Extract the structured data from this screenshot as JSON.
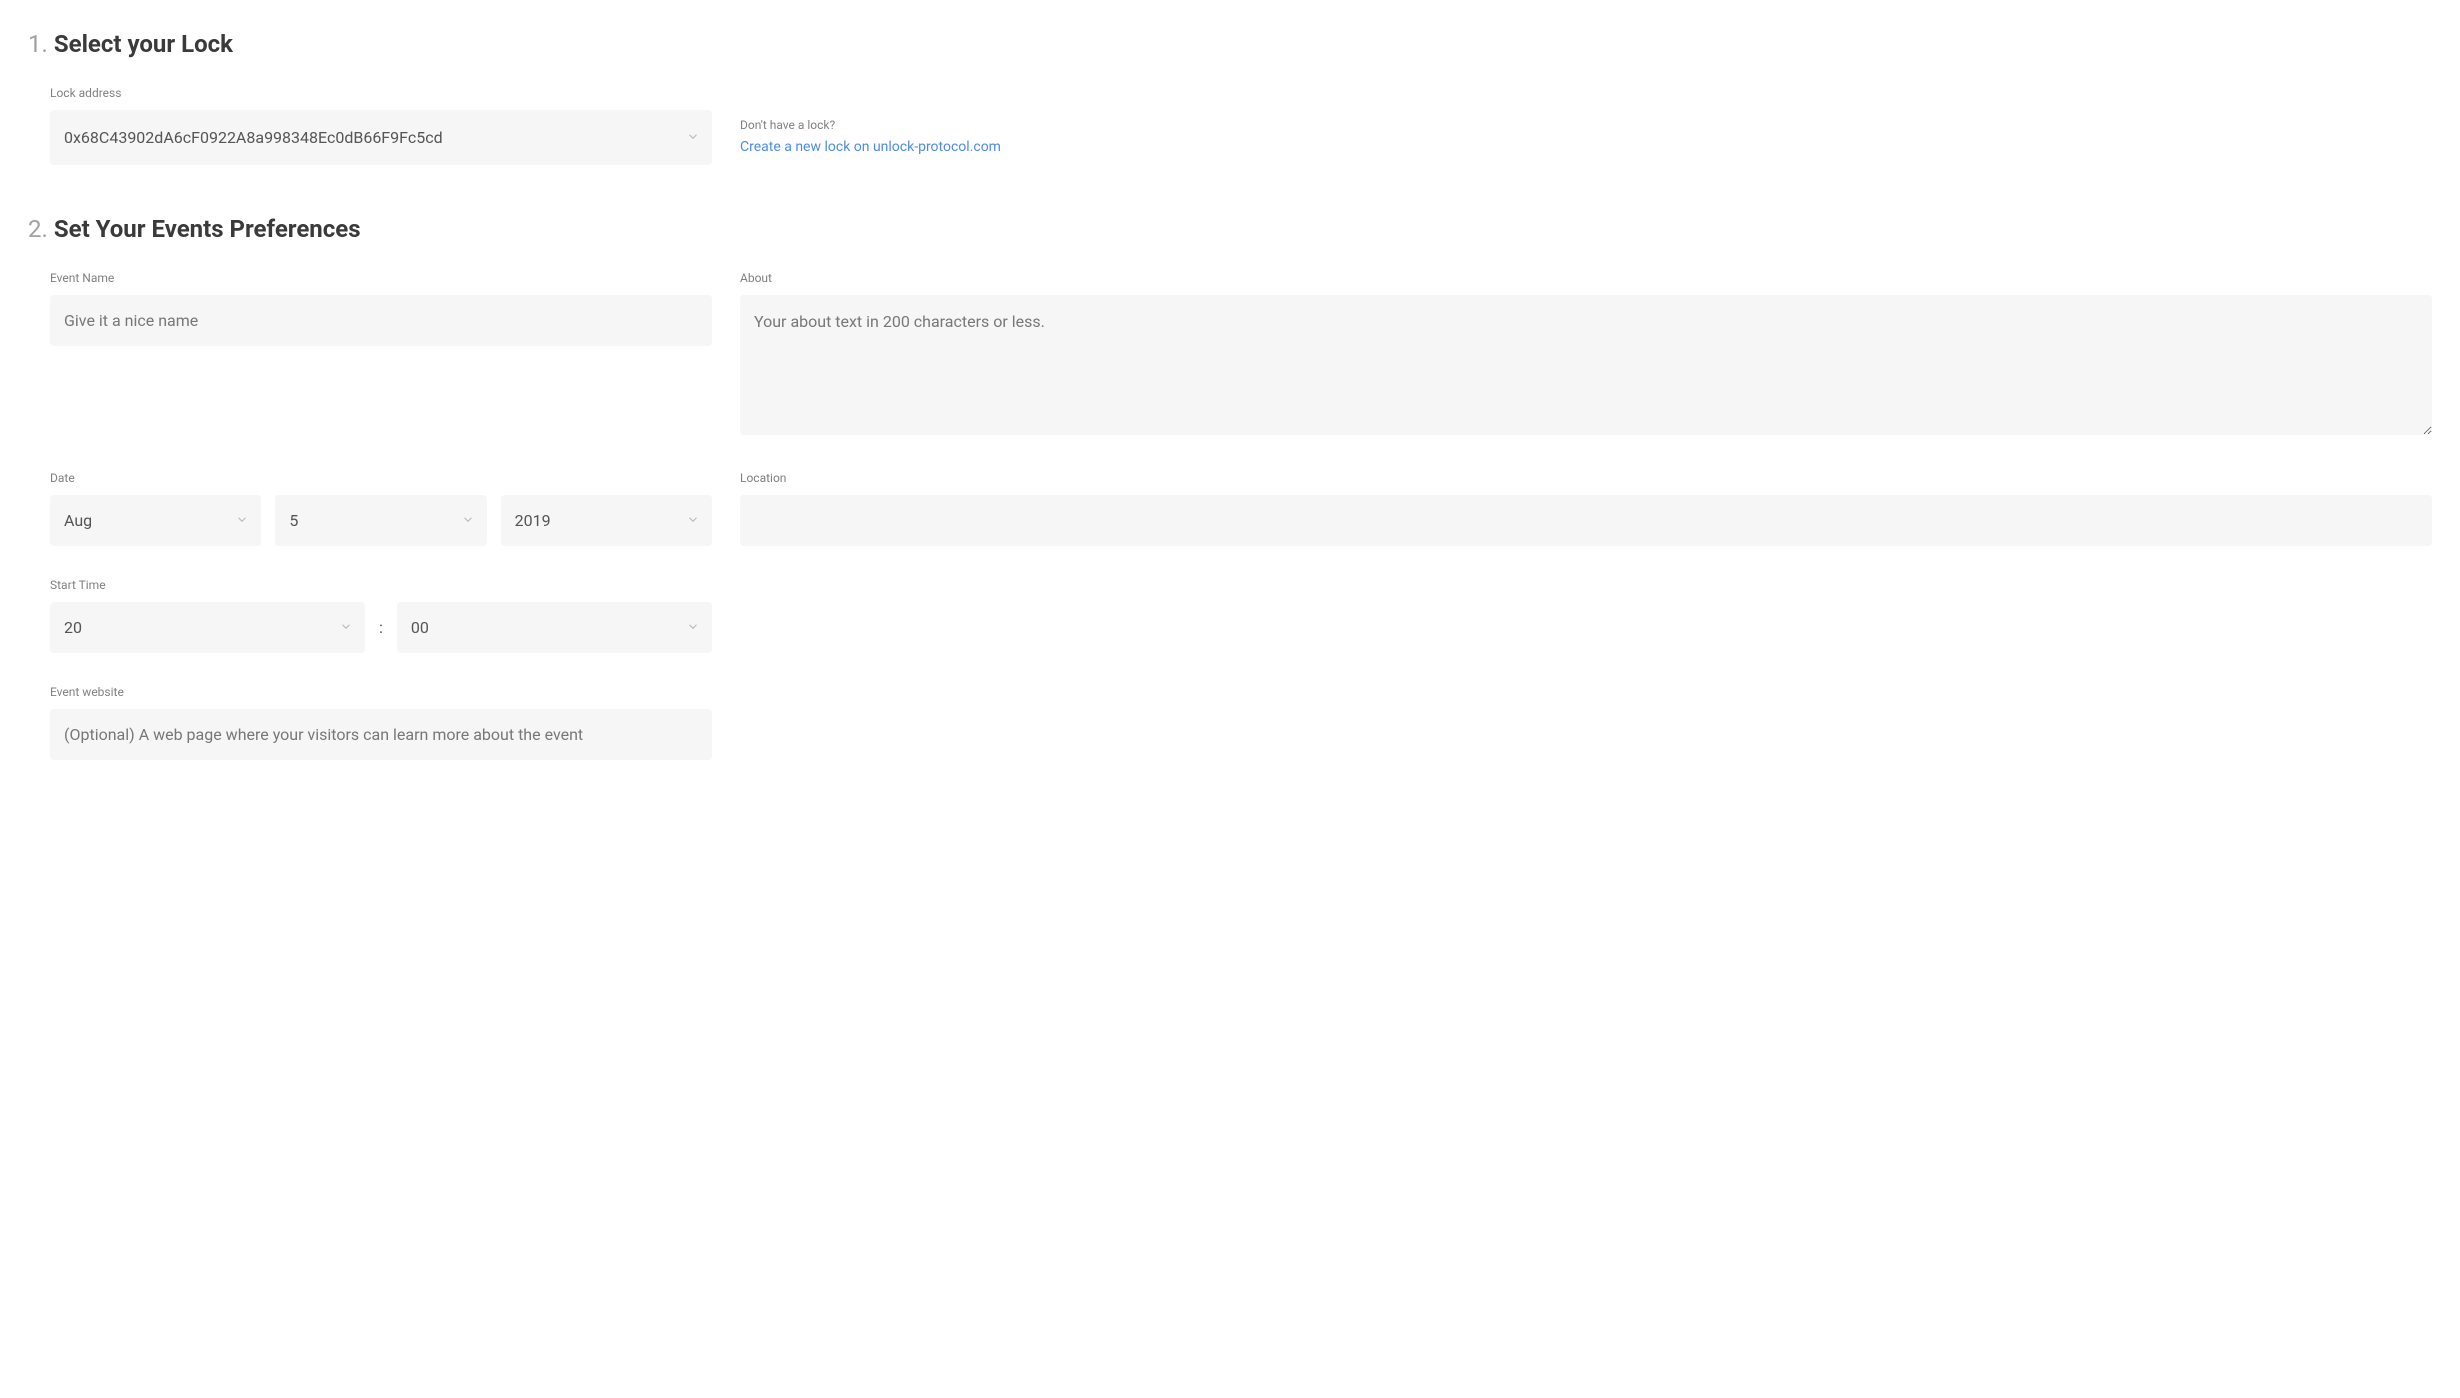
{
  "section1": {
    "number": "1.",
    "title": "Select your Lock",
    "lockAddressLabel": "Lock address",
    "lockAddressValue": "0x68C43902dA6cF0922A8a998348Ec0dB66F9Fc5cd",
    "helperText": "Don't have a lock?",
    "helperLink": "Create a new lock on unlock-protocol.com"
  },
  "section2": {
    "number": "2.",
    "title": "Set Your Events Preferences",
    "eventNameLabel": "Event Name",
    "eventNamePlaceholder": "Give it a nice name",
    "aboutLabel": "About",
    "aboutPlaceholder": "Your about text in 200 characters or less.",
    "dateLabel": "Date",
    "dateMonth": "Aug",
    "dateDay": "5",
    "dateYear": "2019",
    "locationLabel": "Location",
    "locationValue": "",
    "startTimeLabel": "Start Time",
    "startHour": "20",
    "startMinute": "00",
    "timeSeparator": ":",
    "eventWebsiteLabel": "Event website",
    "eventWebsitePlaceholder": "(Optional) A web page where your visitors can learn more about the event"
  }
}
